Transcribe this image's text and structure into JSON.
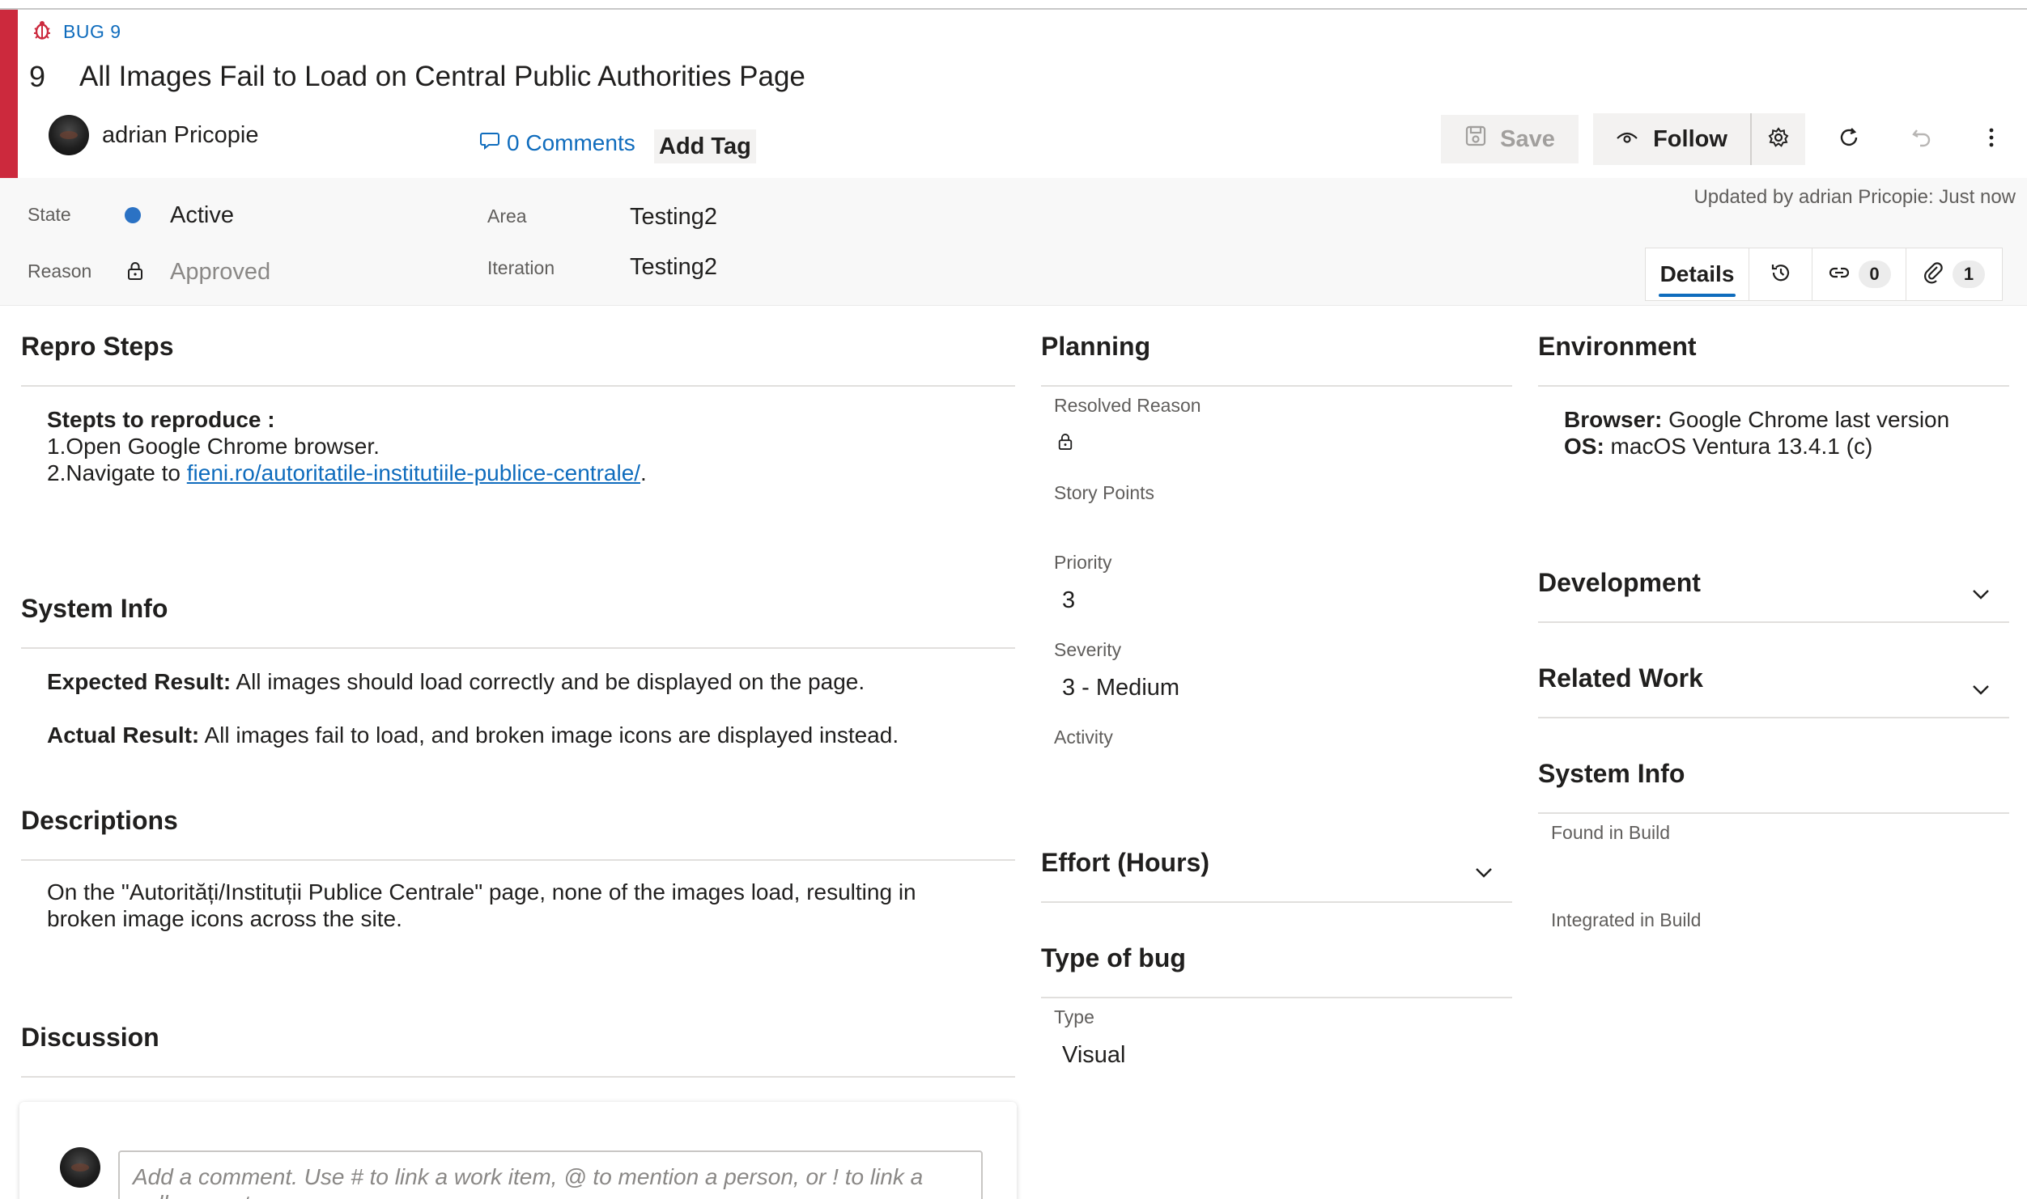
{
  "workitem": {
    "type_label": "BUG 9",
    "id": "9",
    "title": "All Images Fail to Load on Central Public Authorities Page",
    "author": "adrian Pricopie",
    "comments_label": "0 Comments",
    "add_tag_label": "Add Tag",
    "accent_color": "#cc293d"
  },
  "toolbar": {
    "save_label": "Save",
    "follow_label": "Follow"
  },
  "meta": {
    "state_label": "State",
    "state_value": "Active",
    "state_color": "#2b72c4",
    "reason_label": "Reason",
    "reason_value": "Approved",
    "area_label": "Area",
    "area_value": "Testing2",
    "iteration_label": "Iteration",
    "iteration_value": "Testing2",
    "updated_text": "Updated by adrian Pricopie: Just now"
  },
  "tabs": {
    "details_label": "Details",
    "links_count": "0",
    "attachments_count": "1"
  },
  "repro": {
    "title": "Repro Steps",
    "heading": "Stepts to reproduce :",
    "step1": "1.Open Google Chrome browser.",
    "step2_prefix": "2.Navigate to ",
    "step2_link": "fieni.ro/autoritatile-institutiile-publice-centrale/",
    "step2_suffix": "."
  },
  "system_info_left": {
    "title": "System Info",
    "expected_label": "Expected Result:",
    "expected_text": " All images should load correctly and be displayed on the page.",
    "actual_label": "Actual Result:",
    "actual_text": " All images fail to load, and broken image icons are displayed instead."
  },
  "descriptions": {
    "title": "Descriptions",
    "line1": "On the \"Autorități/Instituții Publice Centrale\" page, none of the images load, resulting in",
    "line2": "broken image icons across the site."
  },
  "discussion": {
    "title": "Discussion",
    "placeholder_line1": "Add a comment. Use # to link a work item, @ to mention a person, or ! to link a",
    "placeholder_line2": "pull request."
  },
  "planning": {
    "title": "Planning",
    "resolved_reason_label": "Resolved Reason",
    "story_points_label": "Story Points",
    "priority_label": "Priority",
    "priority_value": "3",
    "severity_label": "Severity",
    "severity_value": "3 - Medium",
    "activity_label": "Activity"
  },
  "effort": {
    "title": "Effort (Hours)"
  },
  "type_of_bug": {
    "title": "Type of bug",
    "type_label": "Type",
    "type_value": "Visual"
  },
  "environment": {
    "title": "Environment",
    "browser_label": "Browser:",
    "browser_value": " Google Chrome last version",
    "os_label": "OS:",
    "os_value": " macOS Ventura 13.4.1 (c)"
  },
  "development": {
    "title": "Development"
  },
  "related_work": {
    "title": "Related Work"
  },
  "system_info_right": {
    "title": "System Info",
    "found_label": "Found in Build",
    "integrated_label": "Integrated in Build"
  }
}
